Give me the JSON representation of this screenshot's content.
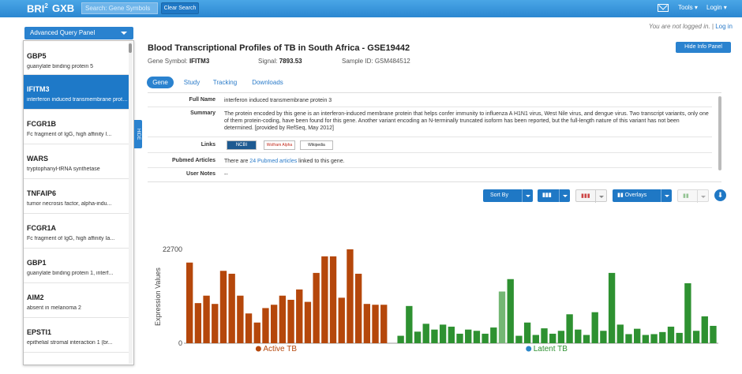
{
  "topbar": {
    "brand": "BRI",
    "brand_sup": "2",
    "app": "GXB",
    "search_placeholder": "Search: Gene Symbols",
    "clear_label": "Clear Search",
    "tools": "Tools ▾",
    "login": "Login ▾"
  },
  "status": {
    "not_logged": "You are not logged in.",
    "login_link": "Log in"
  },
  "sidebar": {
    "aqp_label": "Advanced Query Panel",
    "hide_label": "HIDE",
    "items": [
      {
        "symbol": "GBP5",
        "desc": "guanylate binding protein 5"
      },
      {
        "symbol": "IFITM3",
        "desc": "interferon induced transmembrane protein 3",
        "selected": true
      },
      {
        "symbol": "FCGR1B",
        "desc": "Fc fragment of IgG, high affinity I..."
      },
      {
        "symbol": "WARS",
        "desc": "tryptophanyl-tRNA synthetase"
      },
      {
        "symbol": "TNFAIP6",
        "desc": "tumor necrosis factor, alpha-indu..."
      },
      {
        "symbol": "FCGR1A",
        "desc": "Fc fragment of IgG, high affinity Ia..."
      },
      {
        "symbol": "GBP1",
        "desc": "guanylate binding protein 1, interf..."
      },
      {
        "symbol": "AIM2",
        "desc": "absent in melanoma 2"
      },
      {
        "symbol": "EPSTI1",
        "desc": "epithelial stromal interaction 1 (br..."
      }
    ]
  },
  "header": {
    "title": "Blood Transcriptional Profiles of TB in South Africa - GSE19442",
    "hide_panel": "Hide Info Panel",
    "gene_symbol_label": "Gene Symbol:",
    "gene_symbol": "IFITM3",
    "signal_label": "Signal:",
    "signal": "7893.53",
    "sample_label": "Sample ID:",
    "sample": "GSM484512"
  },
  "tabs": [
    "Gene",
    "Study",
    "Tracking",
    "Downloads"
  ],
  "info": {
    "full_name_label": "Full Name",
    "full_name": "interferon induced transmembrane protein 3",
    "summary_label": "Summary",
    "summary": "The protein encoded by this gene is an interferon-induced membrane protein that helps confer immunity to influenza A H1N1 virus, West Nile virus, and dengue virus. Two transcript variants, only one of them protein-coding, have been found for this gene. Another variant encoding an N-terminally truncated isoform has been reported, but the full-length nature of this variant has not been determined. [provided by RefSeq, May 2012]",
    "links_label": "Links",
    "links": [
      "NCBI",
      "Wolfram Alpha",
      "Wikipedia"
    ],
    "pubmed_label": "Pubmed Articles",
    "pubmed_pre": "There are ",
    "pubmed_link": "24 Pubmed articles",
    "pubmed_post": " linked to this gene.",
    "usernotes_label": "User Notes",
    "usernotes": "--"
  },
  "toolbar": {
    "sort_by": "Sort By",
    "overlays": "Overlays"
  },
  "chart_data": {
    "type": "bar",
    "ylabel": "Expression Values",
    "ymax_label": "22700",
    "ymin_label": "0",
    "ylim": [
      0,
      22700
    ],
    "series": [
      {
        "name": "Active TB",
        "color": "#b5470b",
        "values": [
          19500,
          9700,
          11500,
          9500,
          17500,
          16800,
          11500,
          7200,
          5000,
          8500,
          9300,
          11500,
          10500,
          13000,
          10000,
          17000,
          21000,
          21000,
          11000,
          22700,
          16800,
          9500,
          9300,
          9300
        ]
      },
      {
        "name": "Latent TB",
        "color": "#2e9131",
        "values": [
          1800,
          9000,
          2800,
          4700,
          3300,
          4500,
          4000,
          2300,
          3300,
          3000,
          2300,
          3800,
          12500,
          15500,
          1800,
          5000,
          2000,
          3600,
          2300,
          3000,
          7000,
          3300,
          2000,
          7500,
          3000,
          17000,
          4500,
          2200,
          3500,
          2000,
          2200,
          2700,
          4000,
          2500,
          14500,
          3000,
          6500,
          4200
        ]
      }
    ],
    "highlight_index": {
      "series": 1,
      "index": 12,
      "color": "#74b774"
    }
  }
}
